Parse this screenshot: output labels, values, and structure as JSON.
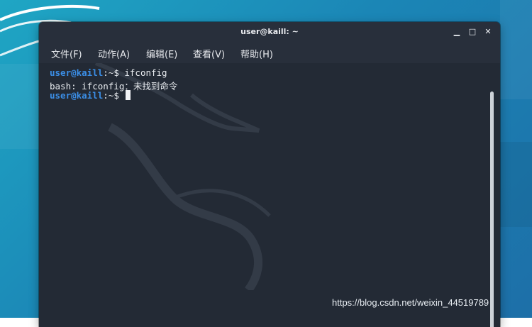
{
  "window": {
    "title": "user@kaill: ~",
    "minimize_glyph": "▁",
    "maximize_glyph": "□",
    "close_glyph": "✕"
  },
  "menu": {
    "file": "文件(F)",
    "edit_action": "动作(A)",
    "edit": "编辑(E)",
    "view": "查看(V)",
    "help": "帮助(H)"
  },
  "terminal": {
    "lines": [
      {
        "user": "user@kaill",
        "sep": ":~$ ",
        "text": "ifconfig"
      },
      {
        "text": "bash: ifconfig：未找到命令"
      },
      {
        "user": "user@kaill",
        "sep": ":~$ ",
        "text": ""
      }
    ]
  },
  "watermark": "https://blog.csdn.net/weixin_44519789",
  "colors": {
    "desktop": "#1b86b6",
    "terminal_bg": "#232a35",
    "prompt": "#3b8ee6"
  },
  "icons": {
    "minimize": "minimize-icon",
    "maximize": "maximize-icon",
    "close": "close-icon",
    "wallpaper": "kali-dragon-logo"
  }
}
